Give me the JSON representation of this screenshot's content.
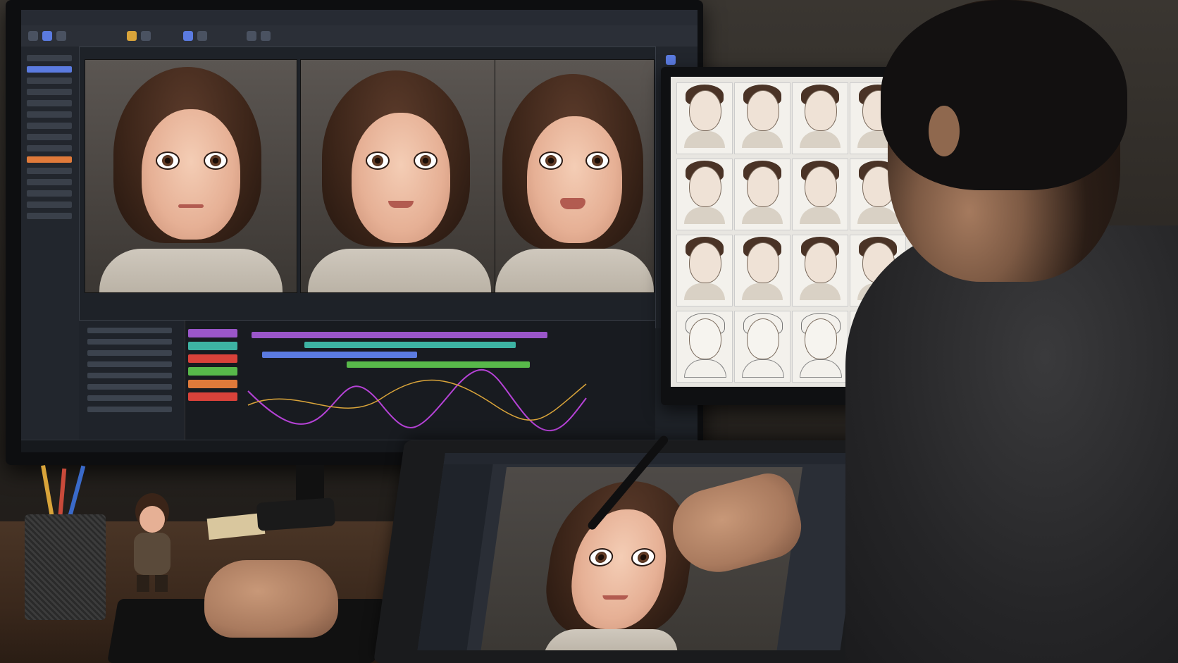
{
  "scene": "",
  "colors": {
    "accent": "#5b7be0",
    "trackPurple": "#9a56c9",
    "trackTeal": "#3db3a3",
    "trackOrange": "#e07a3a",
    "trackGreen": "#58b94a",
    "trackRed": "#d9423a",
    "curve": "#b542d6"
  }
}
